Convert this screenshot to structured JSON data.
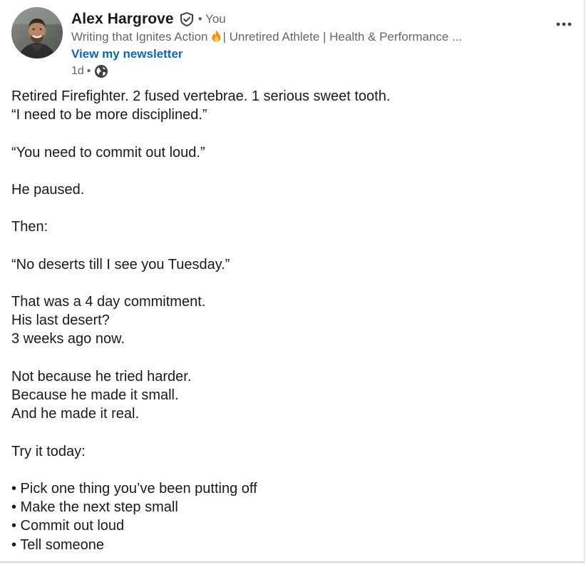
{
  "author": {
    "name": "Alex Hargrove",
    "relation": "• You",
    "tagline_before": "Writing that Ignites Action",
    "tagline_after": "| Unretired Athlete | Health & Performance ...",
    "newsletter_link": "View my newsletter",
    "time_ago": "1d",
    "meta_dot": "•"
  },
  "icons": {
    "verified": "verified-shield-icon",
    "flame": "flame-emoji-icon",
    "visibility": "globe-icon",
    "menu": "more-options-icon"
  },
  "colors": {
    "link": "#0a66c2",
    "secondary_text": "#666666",
    "primary_text": "#1a1a1a"
  },
  "post": {
    "lines": [
      "Retired Firefighter. 2 fused vertebrae. 1 serious sweet tooth.",
      "“I need to be more disciplined.”",
      "",
      "“You need to commit out loud.”",
      "",
      "He paused.",
      "",
      "Then:",
      "",
      "“No deserts till I see you Tuesday.”",
      "",
      "That was a 4 day commitment.",
      "His last desert?",
      "3 weeks ago now.",
      "",
      "Not because he tried harder.",
      "Because he made it small.",
      "And he made it real.",
      "",
      "Try it today:",
      "",
      "• Pick one thing you’ve been putting off",
      "• Make the next step small",
      "• Commit out loud",
      "• Tell someone"
    ]
  }
}
